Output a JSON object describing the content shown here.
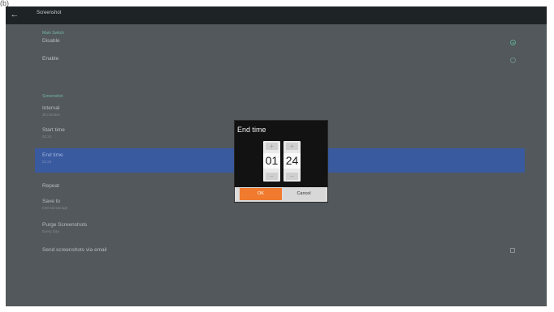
{
  "corner_mark": "(b)",
  "appbar": {
    "title": "Screenshot",
    "back_icon": "arrow-left-icon"
  },
  "main_switch": {
    "header": "Main Switch",
    "options": [
      {
        "label": "Disable",
        "selected": true
      },
      {
        "label": "Enable",
        "selected": false
      }
    ]
  },
  "screenshot_section": {
    "header": "Screenshot",
    "interval": {
      "title": "Interval",
      "value": "30 minutes"
    },
    "start_time": {
      "title": "Start time",
      "value": "01:24"
    },
    "end_time": {
      "title": "End time",
      "value": "01:24"
    },
    "repeat": {
      "title": "Repeat"
    },
    "save_to": {
      "title": "Save to",
      "value": "Internal storage"
    },
    "purge": {
      "title": "Purge Screenshots",
      "value": "Every Day"
    },
    "send_email": {
      "title": "Send screenshots via email",
      "checked": false
    }
  },
  "dialog": {
    "title": "End time",
    "hour": "01",
    "minute": "24",
    "increment_glyph": "+",
    "decrement_glyph": "−",
    "ok_label": "OK",
    "cancel_label": "Cancel"
  },
  "colors": {
    "accent_green": "#5fa88f",
    "selection_blue": "#3a5aa0",
    "ok_orange": "#f07a2e"
  }
}
